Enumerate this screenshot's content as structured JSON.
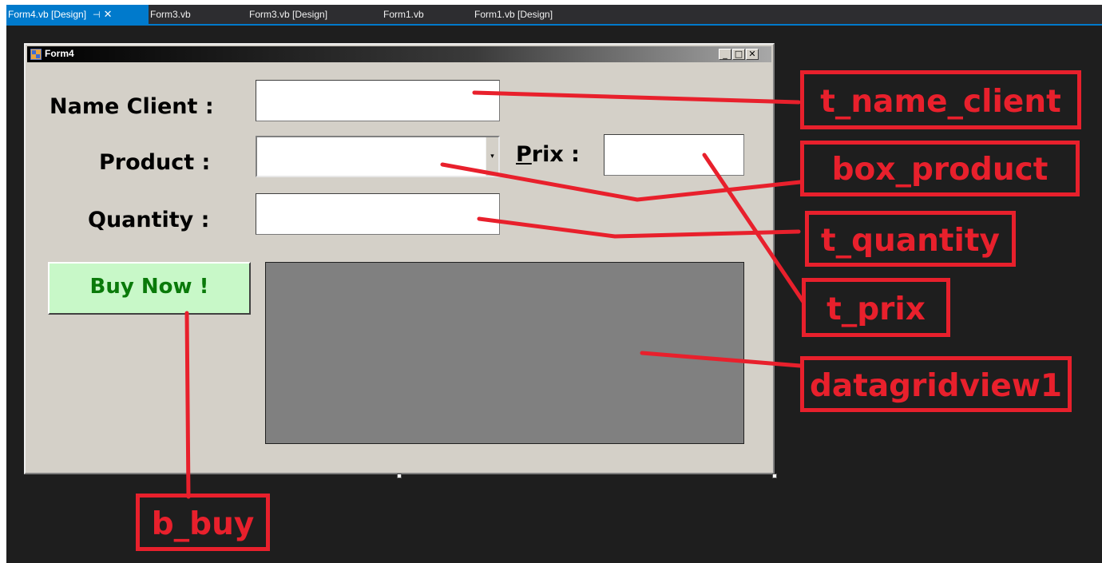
{
  "tabs": [
    {
      "label": "Form4.vb [Design]",
      "active": true
    },
    {
      "label": "Form3.vb",
      "active": false
    },
    {
      "label": "Form3.vb [Design]",
      "active": false
    },
    {
      "label": "Form1.vb",
      "active": false
    },
    {
      "label": "Form1.vb [Design]",
      "active": false
    }
  ],
  "tab_icons": {
    "pin": "pin-icon",
    "close": "close-icon"
  },
  "form": {
    "title": "Form4",
    "title_buttons": {
      "minimize": "minimize-icon",
      "maximize": "maximize-icon",
      "close": "close-icon"
    }
  },
  "labels": {
    "name_client": "Name Client :",
    "product": "Product :",
    "prix_mnemonic": "P",
    "prix_rest": "rix :",
    "quantity": "Quantity :"
  },
  "fields": {
    "name_client": "",
    "product": "",
    "prix": "",
    "quantity": ""
  },
  "buy_button": "Buy Now !",
  "annotations": {
    "t_name_client": "t_name_client",
    "box_product": "box_product",
    "t_quantity": "t_quantity",
    "t_prix": "t_prix",
    "datagridview1": "datagridview1",
    "b_buy": "b_buy"
  },
  "colors": {
    "accent": "#007acc",
    "annotation": "#e8202c",
    "ide_background": "#1e1e1e",
    "form_background": "#d4d0c8",
    "button_background": "#c8f8c8",
    "button_text": "#0a7a0a",
    "grid_background": "#808080"
  }
}
